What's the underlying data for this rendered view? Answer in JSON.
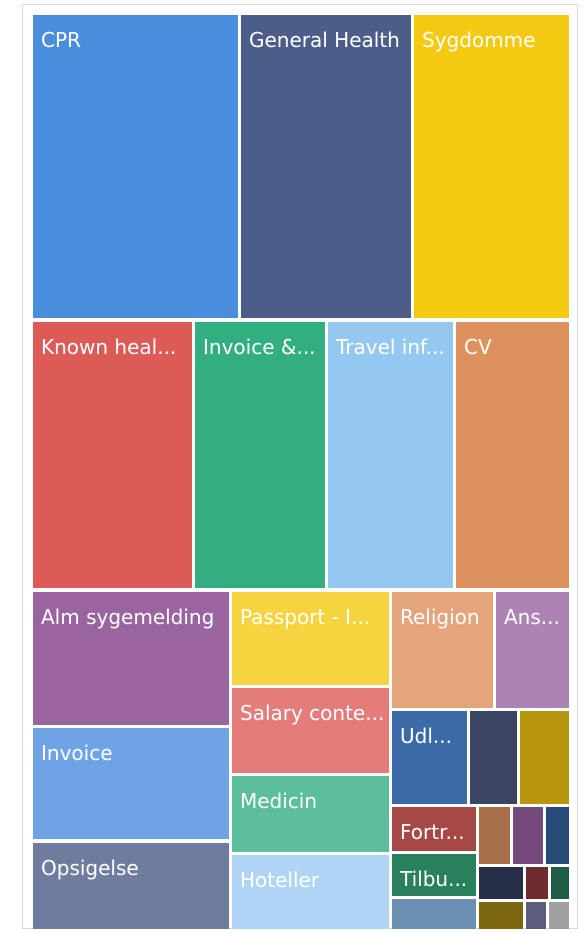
{
  "chart_data": {
    "type": "treemap",
    "tiles": [
      {
        "label": "CPR",
        "color": "#4a8ddc"
      },
      {
        "label": "General Health",
        "color": "#4c5d8a"
      },
      {
        "label": "Sygdomme",
        "color": "#f3c911"
      },
      {
        "label": "Known heal...",
        "color": "#dc5b57"
      },
      {
        "label": "Invoice &...",
        "color": "#33ae81"
      },
      {
        "label": "Travel inf...",
        "color": "#95c8f0"
      },
      {
        "label": "CV",
        "color": "#dd915f"
      },
      {
        "label": "Alm sygemelding",
        "color": "#9a64a0"
      },
      {
        "label": "Invoice",
        "color": "#6ea3e5"
      },
      {
        "label": "Opsigelse",
        "color": "#707c9d"
      },
      {
        "label": "Passport - I...",
        "color": "#f5d440"
      },
      {
        "label": "Salary conte...",
        "color": "#e47c79"
      },
      {
        "label": "Medicin",
        "color": "#5cbe9a"
      },
      {
        "label": "Hoteller",
        "color": "#afd4f4"
      },
      {
        "label": "Religion",
        "color": "#e4a47c"
      },
      {
        "label": "Ans...",
        "color": "#ad83b3"
      },
      {
        "label": "Udl...",
        "color": "#3b6aa6"
      },
      {
        "label": "",
        "color": "#3a4463"
      },
      {
        "label": "",
        "color": "#b8950f"
      },
      {
        "label": "Fortr...",
        "color": "#a64845"
      },
      {
        "label": "",
        "color": "#a86f4b"
      },
      {
        "label": "",
        "color": "#744a7a"
      },
      {
        "label": "",
        "color": "#284a78"
      },
      {
        "label": "Tilbu...",
        "color": "#28805d"
      },
      {
        "label": "",
        "color": "#262e48"
      },
      {
        "label": "",
        "color": "#6e2a2c"
      },
      {
        "label": "",
        "color": "#1f5c44"
      },
      {
        "label": "",
        "color": "#6a90b4"
      },
      {
        "label": "",
        "color": "#7c6610"
      },
      {
        "label": "",
        "color": "#5c5c7c"
      },
      {
        "label": "",
        "color": "#a0a0a0"
      }
    ]
  }
}
